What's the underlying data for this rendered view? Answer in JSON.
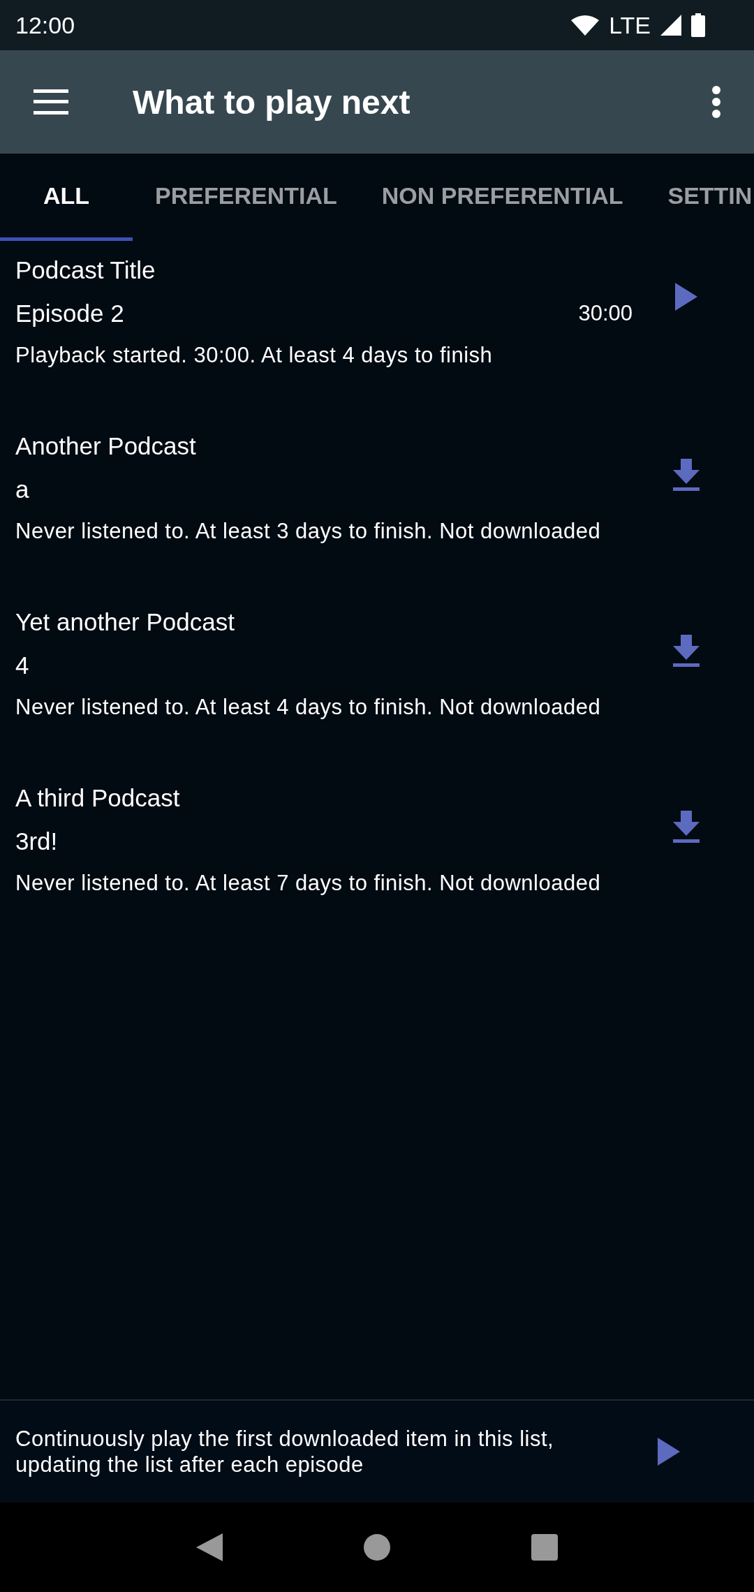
{
  "status_bar": {
    "time": "12:00",
    "network": "LTE"
  },
  "app_bar": {
    "title": "What to play next"
  },
  "tabs": [
    {
      "label": "ALL",
      "selected": true
    },
    {
      "label": "PREFERENTIAL",
      "selected": false
    },
    {
      "label": "NON PREFERENTIAL",
      "selected": false
    },
    {
      "label": "SETTIN",
      "selected": false
    }
  ],
  "episodes": [
    {
      "podcast": "Podcast Title",
      "episode": "Episode 2",
      "duration": "30:00",
      "status": "Playback started. 30:00. At least 4 days to finish",
      "kind": "play"
    },
    {
      "podcast": "Another Podcast",
      "episode": "a",
      "status": "Never listened to. At least 3 days to finish. Not downloaded",
      "kind": "download"
    },
    {
      "podcast": "Yet another Podcast",
      "episode": "4",
      "status": "Never listened to. At least 4 days to finish. Not downloaded",
      "kind": "download"
    },
    {
      "podcast": "A third Podcast",
      "episode": "3rd!",
      "status": "Never listened to. At least 7 days to finish. Not downloaded",
      "kind": "download"
    }
  ],
  "bottom_bar": {
    "text": "Continuously play the first downloaded item in this list, updating the list after each episode"
  }
}
